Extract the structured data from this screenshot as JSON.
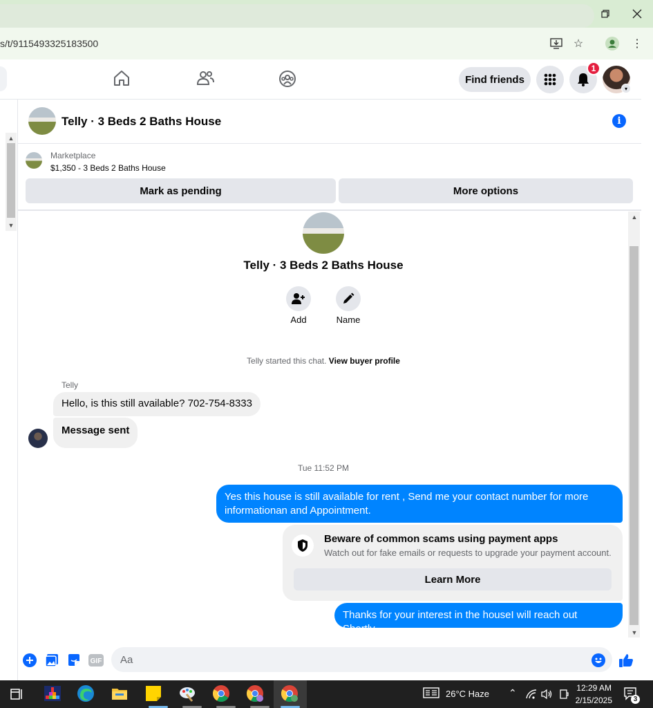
{
  "browser": {
    "url": "s/t/9115493325183500",
    "icons": [
      "minimize-icon",
      "restore-icon",
      "close-icon",
      "install-app-icon",
      "star-icon",
      "profile-icon",
      "kebab-menu-icon"
    ]
  },
  "nav": {
    "find_friends_label": "Find friends",
    "notification_count": "1",
    "icons": [
      "home-icon",
      "friends-icon",
      "groups-icon",
      "menu-grid-icon",
      "bell-icon"
    ]
  },
  "chat": {
    "title": "Telly · 3 Beds 2 Baths House",
    "marketplace_label": "Marketplace",
    "listing": "$1,350 - 3 Beds 2 Baths House",
    "mark_pending_label": "Mark as pending",
    "more_options_label": "More options",
    "profile_name": "Telly · 3 Beds 2 Baths House",
    "add_label": "Add",
    "name_label": "Name",
    "started_text": "Telly started this chat.",
    "view_profile_label": "View buyer profile",
    "sender_name": "Telly",
    "messages": [
      {
        "from": "them",
        "text": "Hello, is this still available? 702-754-8333"
      },
      {
        "from": "them",
        "text": "Message sent"
      },
      {
        "from": "me",
        "text": "Yes this house is still available for rent , Send me your contact number for more informationan and Appointment."
      },
      {
        "from": "me",
        "text": "Thanks for your interest in the houseI will reach out Shortly."
      }
    ],
    "timestamp": "Tue 11:52 PM",
    "scam": {
      "title": "Beware of common scams using payment apps",
      "body": "Watch out for fake emails or requests to upgrade your payment account.",
      "button": "Learn More"
    },
    "composer_placeholder": "Aa",
    "composer_icons": [
      "plus-icon",
      "image-icon",
      "sticker-icon",
      "gif-icon",
      "emoji-icon",
      "thumbs-up-icon"
    ],
    "accent_color": "#0084ff"
  },
  "taskbar": {
    "weather": "26°C  Haze",
    "time": "12:29 AM",
    "date": "2/15/2025",
    "notification_count": "3"
  }
}
